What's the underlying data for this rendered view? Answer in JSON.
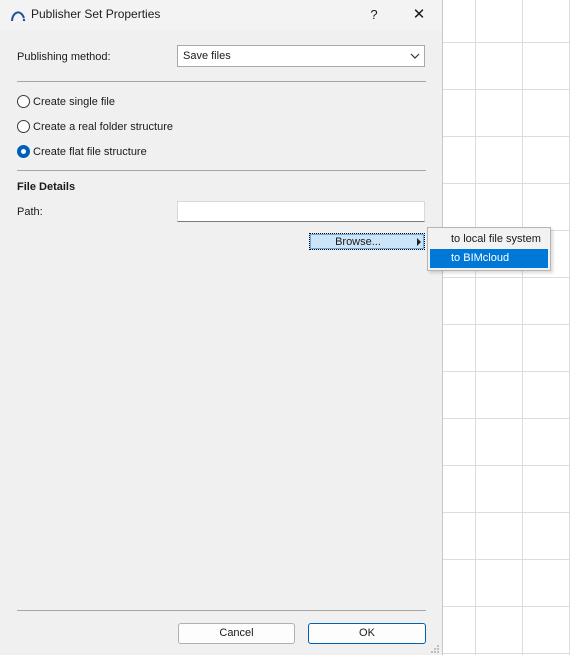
{
  "dialog": {
    "title": "Publisher Set Properties",
    "help_label": "?",
    "close_label": "✕"
  },
  "publishing": {
    "label": "Publishing method:",
    "selected": "Save files"
  },
  "structure_options": [
    {
      "label": "Create single file",
      "checked": false
    },
    {
      "label": "Create a real folder structure",
      "checked": false
    },
    {
      "label": "Create flat file structure",
      "checked": true
    }
  ],
  "file_details": {
    "heading": "File Details",
    "path_label": "Path:",
    "path_value": "",
    "browse_label": "Browse..."
  },
  "browse_menu": {
    "items": [
      {
        "label": "to local file system",
        "highlighted": false
      },
      {
        "label": "to BIMcloud",
        "highlighted": true
      }
    ]
  },
  "footer": {
    "cancel_label": "Cancel",
    "ok_label": "OK"
  },
  "colors": {
    "accent": "#0078d7",
    "dialog_bg": "#f0f0f0",
    "button_highlight": "#cce4f7"
  }
}
